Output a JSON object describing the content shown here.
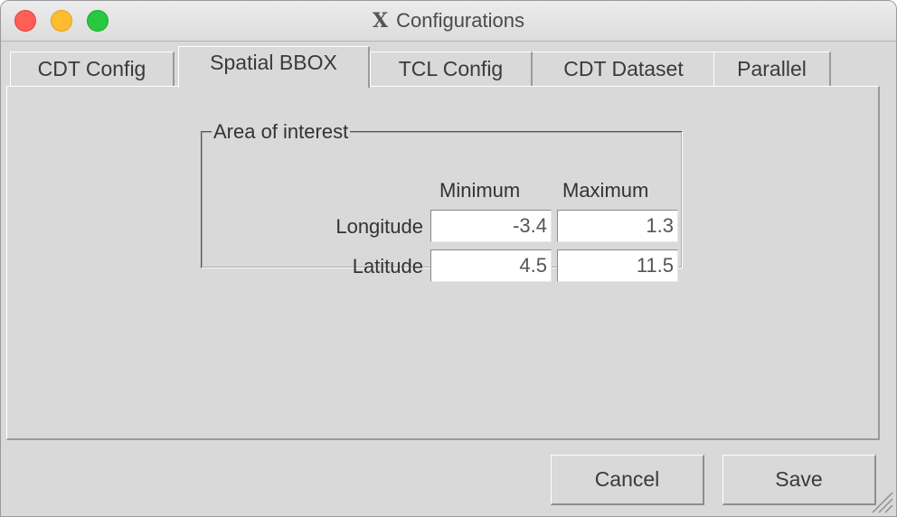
{
  "window": {
    "title": "Configurations",
    "title_icon": "X"
  },
  "tabs": [
    {
      "label": "CDT Config",
      "active": false
    },
    {
      "label": "Spatial BBOX",
      "active": true
    },
    {
      "label": "TCL Config",
      "active": false
    },
    {
      "label": "CDT Dataset",
      "active": false
    },
    {
      "label": "Parallel",
      "active": false
    }
  ],
  "area_of_interest": {
    "legend": "Area of interest",
    "columns": [
      "Minimum",
      "Maximum"
    ],
    "rows": [
      {
        "label": "Longitude",
        "min": "-3.4",
        "max": "1.3"
      },
      {
        "label": "Latitude",
        "min": "4.5",
        "max": "11.5"
      }
    ]
  },
  "buttons": {
    "cancel": "Cancel",
    "save": "Save"
  },
  "colors": {
    "window_bg": "#d9d9d9",
    "close": "#fe5f57",
    "minimize": "#febc2e",
    "maximize": "#28c840"
  }
}
